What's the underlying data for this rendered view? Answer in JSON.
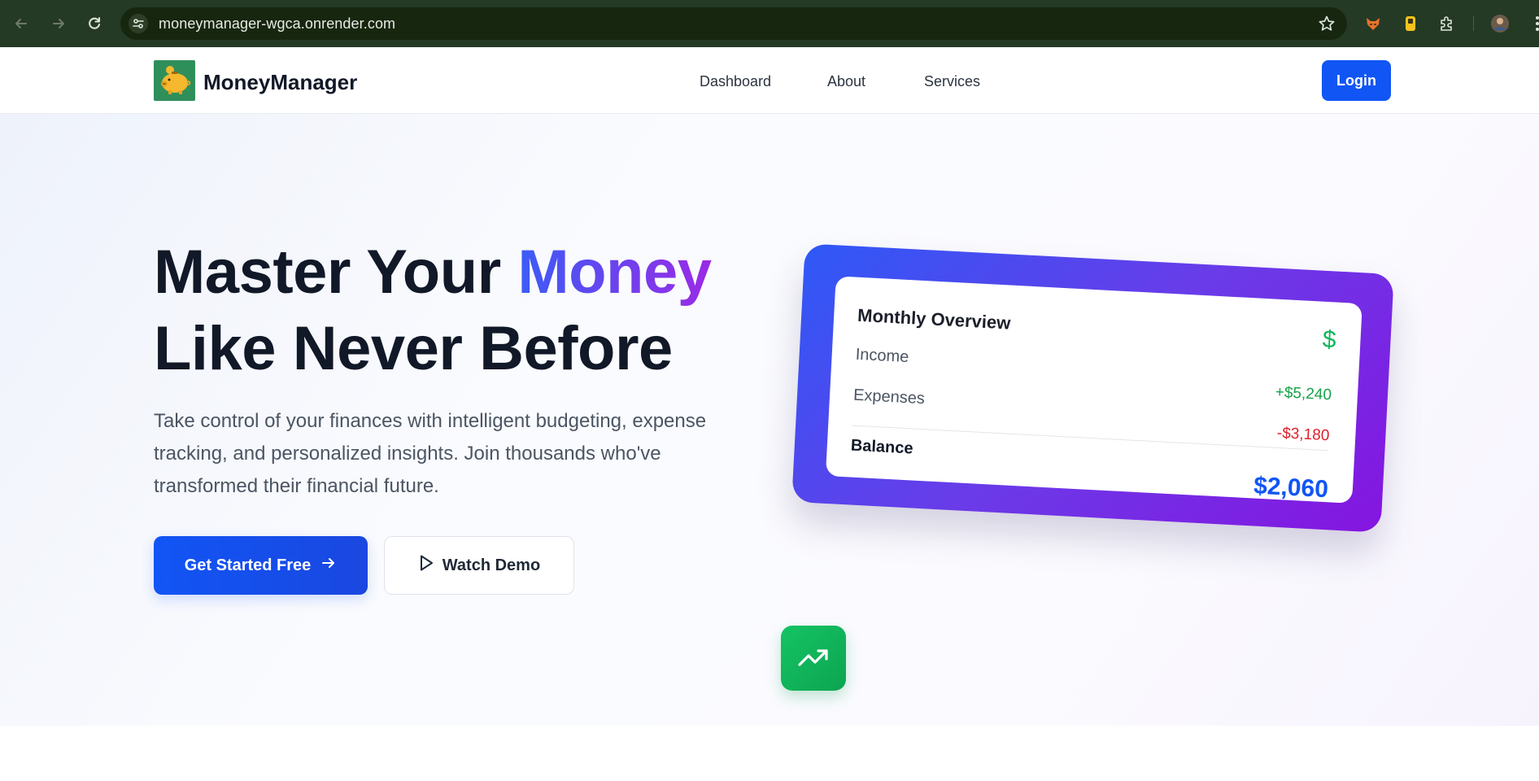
{
  "browser": {
    "url": "moneymanager-wgca.onrender.com"
  },
  "navbar": {
    "brand": "MoneyManager",
    "links": [
      "Dashboard",
      "About",
      "Services"
    ],
    "login_label": "Login"
  },
  "hero": {
    "headline_part1": "Master Your ",
    "headline_accent": "Money",
    "headline_line2": "Like Never Before",
    "subtitle": "Take control of your finances with intelligent budgeting, expense tracking, and personalized insights. Join thousands who've transformed their financial future.",
    "cta_primary": "Get Started Free",
    "cta_secondary": "Watch Demo"
  },
  "overview_card": {
    "title": "Monthly Overview",
    "currency_symbol": "$",
    "income_label": "Income",
    "income_value": "+$5,240",
    "expenses_label": "Expenses",
    "expenses_value": "-$3,180",
    "balance_label": "Balance",
    "balance_value": "$2,060"
  },
  "colors": {
    "brand_blue": "#1155f5",
    "income_green": "#16a34a",
    "expense_red": "#e11d2a",
    "accent_purple": "#9b2ae6"
  },
  "icons": [
    "back-arrow-icon",
    "forward-arrow-icon",
    "reload-icon",
    "site-info-icon",
    "bookmark-star-icon",
    "fox-extension-icon",
    "yellow-extension-icon",
    "puzzle-extensions-icon",
    "profile-avatar-icon",
    "kebab-menu-icon",
    "piggy-bank-icon",
    "arrow-right-icon",
    "play-icon",
    "dollar-icon",
    "trending-up-icon"
  ]
}
